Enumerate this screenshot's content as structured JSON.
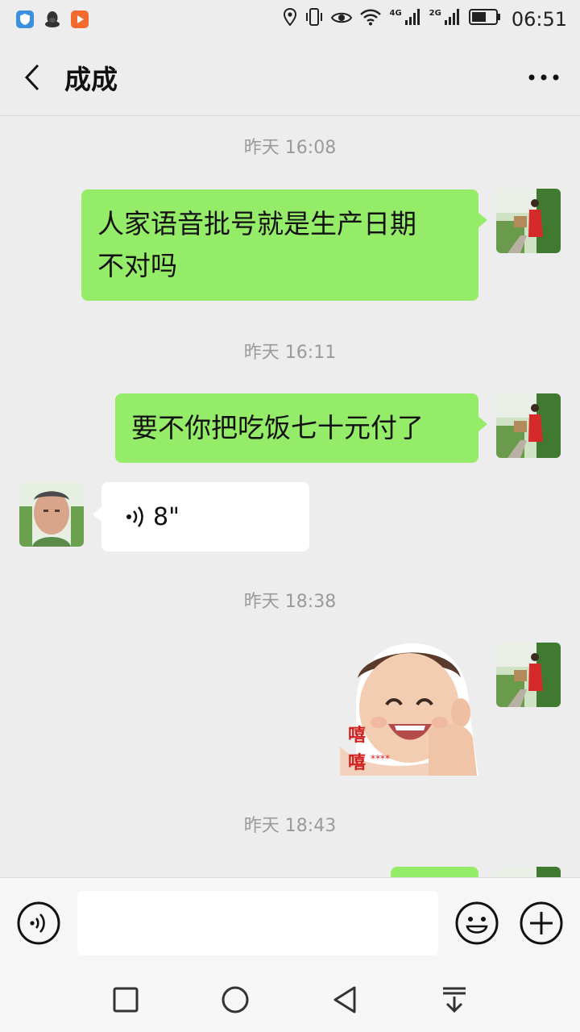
{
  "status_bar": {
    "time": "06:51",
    "network_1": "4G",
    "network_2": "2G",
    "app_icons": [
      "shield-app-icon",
      "qq-penguin-icon",
      "video-app-icon"
    ],
    "icons": [
      "location-icon",
      "vibrate-icon",
      "eye-icon",
      "wifi-icon",
      "signal-icon",
      "battery-icon"
    ]
  },
  "header": {
    "title": "成成",
    "back_icon": "chevron-left-icon",
    "more_icon": "more-dots-icon"
  },
  "messages": [
    {
      "type": "timestamp",
      "text": "昨天 16:08"
    },
    {
      "type": "text",
      "direction": "out",
      "lines": [
        "人家语音批号就是生产日期",
        "不对吗"
      ]
    },
    {
      "type": "timestamp",
      "text": "昨天 16:11"
    },
    {
      "type": "text",
      "direction": "out",
      "lines": [
        "要不你把吃饭七十元付了"
      ]
    },
    {
      "type": "voice",
      "direction": "in",
      "duration": "8\""
    },
    {
      "type": "timestamp",
      "text": "昨天 18:38"
    },
    {
      "type": "sticker",
      "direction": "out",
      "caption_chars": [
        "嘻",
        "嘻"
      ],
      "caption_tail": "****"
    },
    {
      "type": "timestamp",
      "text": "昨天 18:43"
    }
  ],
  "input_bar": {
    "voice_icon": "voice-input-icon",
    "emoji_icon": "emoji-icon",
    "plus_icon": "plus-icon",
    "input_value": ""
  },
  "nav_bar": {
    "icons": [
      "recent-apps-icon",
      "home-icon",
      "back-icon",
      "notification-pull-icon"
    ]
  },
  "colors": {
    "bubble_out": "#95ec69",
    "bubble_in": "#ffffff",
    "background": "#ededed",
    "timestamp": "#9a9a9a"
  }
}
